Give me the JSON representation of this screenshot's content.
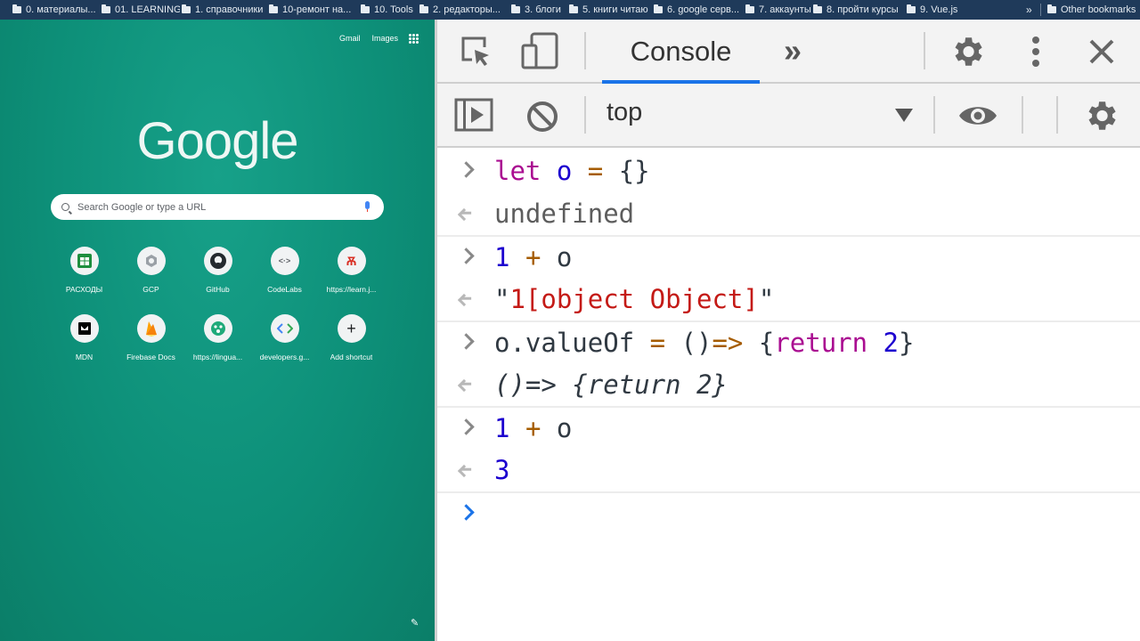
{
  "bookmarks": {
    "items": [
      "0. материалы...",
      "01. LEARNING",
      "1. справочники",
      "10-ремонт на...",
      "10. Tools",
      "2. редакторы...",
      "3. блоги",
      "5. книги читаю",
      "6. google серв...",
      "7. аккаунты",
      "8. пройти курсы",
      "9. Vue.js"
    ],
    "overflow": "»",
    "other": "Other bookmarks"
  },
  "ntp": {
    "gmail": "Gmail",
    "images": "Images",
    "logo": "Google",
    "search_placeholder": "Search Google or type a URL",
    "shortcuts": [
      {
        "label": "РАСХОДЫ",
        "icon": "sheets-icon",
        "color": "#1e8e3e"
      },
      {
        "label": "GCP",
        "icon": "gcp-icon",
        "color": "#9aa0a6"
      },
      {
        "label": "GitHub",
        "icon": "github-icon",
        "color": "#24292e"
      },
      {
        "label": "CodeLabs",
        "icon": "codelabs-icon",
        "color": "#5f6368"
      },
      {
        "label": "https://learn.j...",
        "icon": "learn-icon",
        "color": "#d93025"
      },
      {
        "label": "MDN",
        "icon": "mdn-icon",
        "color": "#000000"
      },
      {
        "label": "Firebase Docs",
        "icon": "firebase-icon",
        "color": "#f9ab00"
      },
      {
        "label": "https://lingua...",
        "icon": "lingualeo-icon",
        "color": "#1faa7a"
      },
      {
        "label": "developers.g...",
        "icon": "google-developers-icon",
        "color": "#4285f4"
      },
      {
        "label": "Add shortcut",
        "icon": "plus-icon",
        "color": "#202124"
      }
    ]
  },
  "devtools": {
    "tab": "Console",
    "more_tabs": "»",
    "context": "top",
    "accent": "#1a73e8"
  },
  "console": {
    "entries": [
      {
        "type": "input",
        "tokens": [
          [
            "kw",
            "let"
          ],
          [
            "plain",
            " "
          ],
          [
            "var",
            "o"
          ],
          [
            "plain",
            " "
          ],
          [
            "op",
            "="
          ],
          [
            "plain",
            " {}"
          ]
        ]
      },
      {
        "type": "output",
        "tokens": [
          [
            "muted",
            "undefined"
          ]
        ]
      },
      {
        "type": "input",
        "tokens": [
          [
            "num",
            "1"
          ],
          [
            "plain",
            " "
          ],
          [
            "op",
            "+"
          ],
          [
            "plain",
            " o"
          ]
        ]
      },
      {
        "type": "output",
        "tokens": [
          [
            "plain",
            "\""
          ],
          [
            "str",
            "1[object Object]"
          ],
          [
            "plain",
            "\""
          ]
        ]
      },
      {
        "type": "input",
        "tokens": [
          [
            "plain",
            "o.valueOf "
          ],
          [
            "op",
            "="
          ],
          [
            "plain",
            " ()"
          ],
          [
            "op",
            "=>"
          ],
          [
            "plain",
            " {"
          ],
          [
            "kw",
            "return"
          ],
          [
            "plain",
            " "
          ],
          [
            "num",
            "2"
          ],
          [
            "plain",
            "}"
          ]
        ]
      },
      {
        "type": "output",
        "tokens": [
          [
            "fn-out",
            "()=> {return 2}"
          ]
        ]
      },
      {
        "type": "input",
        "tokens": [
          [
            "num",
            "1"
          ],
          [
            "plain",
            " "
          ],
          [
            "op",
            "+"
          ],
          [
            "plain",
            " o"
          ]
        ]
      },
      {
        "type": "output",
        "tokens": [
          [
            "num",
            "3"
          ]
        ]
      }
    ],
    "prompt_value": ""
  }
}
